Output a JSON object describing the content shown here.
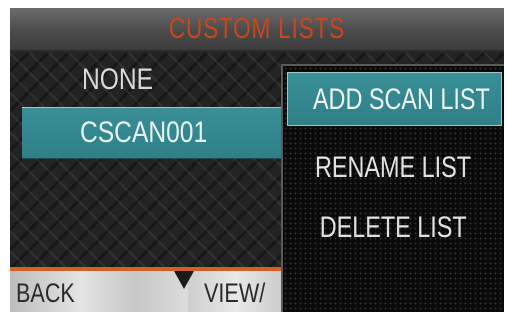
{
  "header": {
    "title": "CUSTOM LISTS"
  },
  "lists": {
    "items": [
      {
        "label": "NONE",
        "selected": false
      },
      {
        "label": "CSCAN001",
        "selected": true
      }
    ]
  },
  "softkeys": {
    "left": "BACK",
    "right": "VIEW/"
  },
  "popup_menu": {
    "items": [
      {
        "label": "ADD SCAN LIST",
        "highlighted": true
      },
      {
        "label": "RENAME LIST",
        "highlighted": false
      },
      {
        "label": "DELETE LIST",
        "highlighted": false
      }
    ]
  },
  "colors": {
    "title_text": "#c9461e",
    "highlight": "#2f7f88",
    "divider": "#d46026",
    "background": "#232323"
  }
}
